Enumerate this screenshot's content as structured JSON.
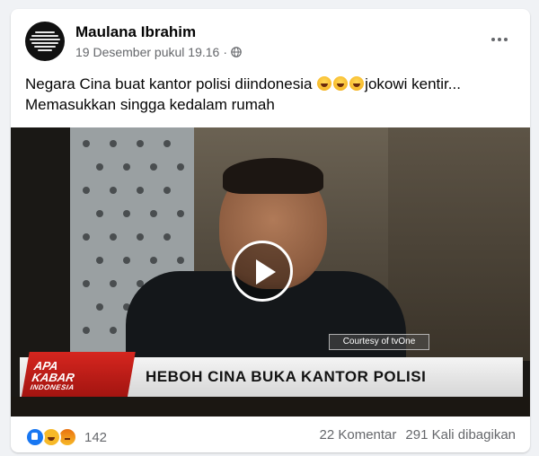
{
  "post": {
    "author": "Maulana Ibrahim",
    "timestamp": "19 Desember pukul 19.16",
    "separator": "·",
    "privacy_icon": "globe-icon",
    "more_icon": "more-options-icon",
    "caption_part1": "Negara Cina buat kantor polisi diindonesia",
    "caption_part2": "jokowi kentir...",
    "caption_line2": "Memasukkan singga kedalam rumah"
  },
  "video": {
    "watermark": "Courtesy of tvOne",
    "ticker_text": "HEBOH CINA BUKA KANTOR POLISI",
    "logo_line1": "APA",
    "logo_line2": "KABAR",
    "logo_line3": "INDONESIA",
    "play_icon": "play-icon"
  },
  "footer": {
    "reaction_count": "142",
    "comments": "22 Komentar",
    "shares": "291 Kali dibagikan"
  },
  "colors": {
    "page_bg": "#f0f2f5",
    "card_bg": "#ffffff",
    "muted_text": "#65676b",
    "like_blue": "#1877f2",
    "ticker_red": "#d6261f"
  }
}
